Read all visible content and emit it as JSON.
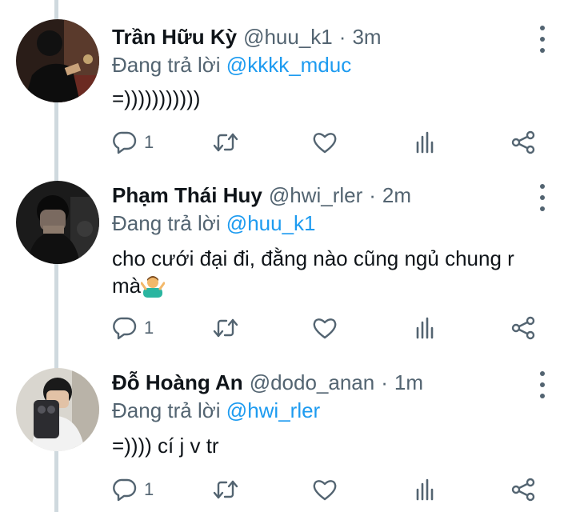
{
  "tweets": [
    {
      "name": "Trần Hữu Kỳ",
      "handle": "@huu_k1",
      "sep": "·",
      "time": "3m",
      "replying_prefix": "Đang trả lời",
      "replying_to": "@kkkk_mduc",
      "lines": [
        "=)))))))))))"
      ],
      "reply_count": "1"
    },
    {
      "name": "Phạm Thái Huy",
      "handle": "@hwi_rler",
      "sep": "·",
      "time": "2m",
      "replying_prefix": "Đang trả lời",
      "replying_to": "@huu_k1",
      "lines": [
        "cho cưới đại đi, đằng nào cũng ngủ chung r",
        "mà"
      ],
      "emoji": "person-shrugging-emoji",
      "reply_count": "1"
    },
    {
      "name": "Đỗ Hoàng An",
      "handle": "@dodo_anan",
      "sep": "·",
      "time": "1m",
      "replying_prefix": "Đang trả lời",
      "replying_to": "@hwi_rler",
      "lines": [
        "=)))) cí j v tr"
      ],
      "reply_count": "1"
    }
  ],
  "icons": {
    "reply": "reply-icon",
    "retweet": "retweet-icon",
    "like": "heart-icon",
    "views": "analytics-icon",
    "share": "share-icon",
    "more": "more-vertical-icon"
  },
  "colors": {
    "text": "#0f1419",
    "secondary": "#536471",
    "mention": "#1d9bf0",
    "thread_line": "#cfd9de"
  }
}
